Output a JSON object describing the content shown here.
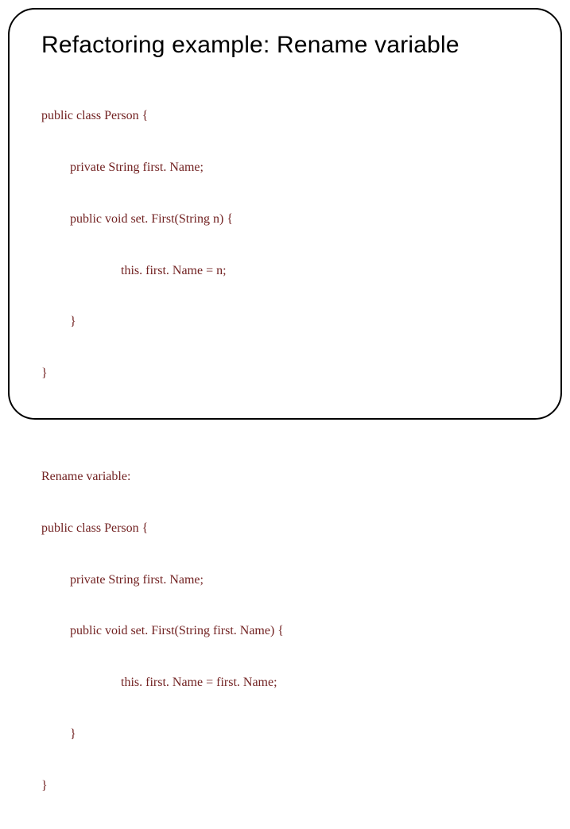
{
  "slide": {
    "title": "Refactoring example: Rename variable",
    "block1": {
      "l1": "public class Person {",
      "l2": "private String first. Name;",
      "l3": "public void set. First(String n) {",
      "l4": "this. first. Name = n;",
      "l5": "}",
      "l6": "}"
    },
    "block2": {
      "l1": "Rename variable:",
      "l2": "public class Person {",
      "l3": "private String first. Name;",
      "l4": "public void set. First(String first. Name) {",
      "l5": "this. first. Name = first. Name;",
      "l6": "}",
      "l7": "}"
    }
  }
}
